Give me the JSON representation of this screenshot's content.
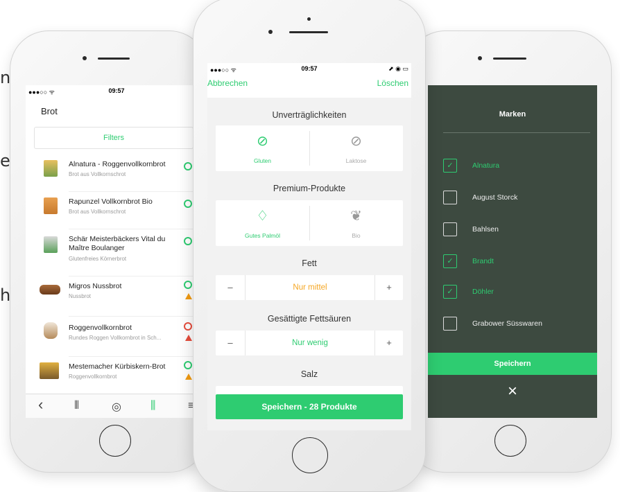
{
  "background_fragments": [
    "n",
    "er",
    "h"
  ],
  "left_phone": {
    "status": {
      "signal": "●●●○○ ᯤ",
      "time": "09:57",
      "right": "⬈"
    },
    "title": "Brot",
    "filters_label": "Filters",
    "products": [
      {
        "name": "Alnatura - Roggenvollkornbrot",
        "sub": "Brot aus Vollkornschrot",
        "score": "green",
        "warning": ""
      },
      {
        "name": "Rapunzel Vollkornbrot Bio",
        "sub": "Brot aus Vollkornschrot",
        "score": "green",
        "warning": ""
      },
      {
        "name": "Schär Meisterbäckers Vital du Maître Boulanger",
        "sub": "Glutenfreies Körnerbrot",
        "score": "green",
        "warning": ""
      },
      {
        "name": "Migros Nussbrot",
        "sub": "Nussbrot",
        "score": "green",
        "warning": "orange"
      },
      {
        "name": "Roggenvollkornbrot",
        "sub": "Rundes Roggen Vollkornbrot in Sch...",
        "score": "red",
        "warning": "red"
      },
      {
        "name": "Mestemacher Kürbiskern-Brot",
        "sub": "Roggenvollkornbrot",
        "score": "green",
        "warning": "orange"
      }
    ],
    "tabbar": [
      {
        "icon": "back-icon",
        "glyph": "‹"
      },
      {
        "icon": "barcode-search-icon",
        "glyph": "⦀"
      },
      {
        "icon": "scan-icon",
        "glyph": "◎"
      },
      {
        "icon": "shelf-icon",
        "glyph": "⫼"
      },
      {
        "icon": "menu-icon",
        "glyph": "≡"
      }
    ]
  },
  "center_phone": {
    "status": {
      "signal": "●●●○○ ᯤ",
      "time": "09:57",
      "right": "⬈ ◉ ▭"
    },
    "cancel": "Abbrechen",
    "delete": "Löschen",
    "sections": {
      "intolerances": "Unverträglichkeiten",
      "premium": "Premium-Produkte",
      "fat": "Fett",
      "saturated": "Gesättigte Fettsäuren",
      "salt": "Salz"
    },
    "intolerance_options": [
      {
        "label": "Gluten",
        "active": true,
        "icon": "gluten-icon"
      },
      {
        "label": "Laktose",
        "active": false,
        "icon": "lactose-icon"
      }
    ],
    "premium_options": [
      {
        "label": "Gutes Palmöl",
        "active": true,
        "icon": "drop-icon"
      },
      {
        "label": "Bio",
        "active": false,
        "icon": "leaf-icon"
      }
    ],
    "fat_value": "Nur mittel",
    "saturated_value": "Nur wenig",
    "minus": "–",
    "plus": "+",
    "save": "Speichern - 28 Produkte",
    "colors": {
      "accent": "#2ecc71",
      "orange": "#f5a623"
    }
  },
  "right_phone": {
    "title": "Marken",
    "brands": [
      {
        "label": "Alnatura",
        "checked": true
      },
      {
        "label": "August Storck",
        "checked": false
      },
      {
        "label": "Bahlsen",
        "checked": false
      },
      {
        "label": "Brandt",
        "checked": true
      },
      {
        "label": "Döhler",
        "checked": true
      },
      {
        "label": "Grabower Süsswaren",
        "checked": false
      }
    ],
    "save": "Speichern",
    "close": "×",
    "check_glyph": "✓"
  }
}
